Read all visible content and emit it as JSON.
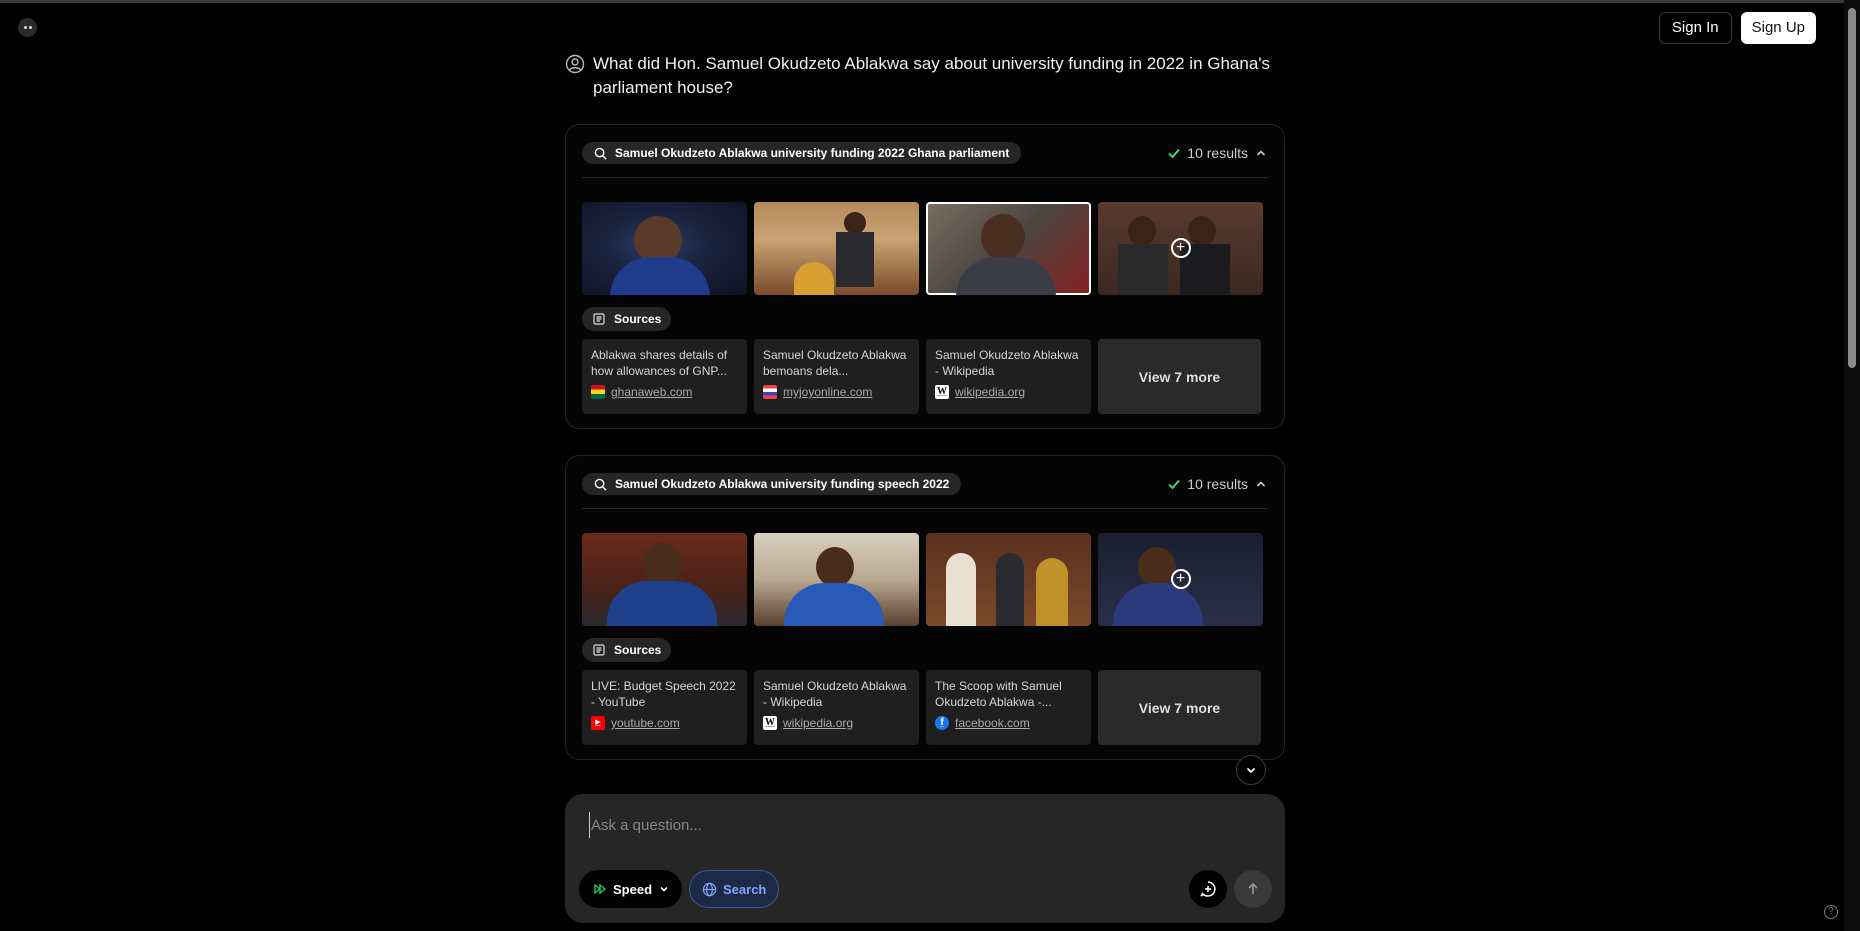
{
  "header": {
    "sign_in": "Sign In",
    "sign_up": "Sign Up"
  },
  "question": "What did Hon. Samuel Okudzeto Ablakwa say about university funding in 2022 in Ghana's parliament house?",
  "searches": [
    {
      "query": "Samuel Okudzeto Ablakwa university funding 2022 Ghana parliament",
      "results": "10 results",
      "sources_label": "Sources",
      "sources": [
        {
          "title": "Ablakwa shares details of how allowances of GNP...",
          "site": "ghanaweb.com",
          "favicon": "ghanaweb-icon"
        },
        {
          "title": "Samuel Okudzeto Ablakwa bemoans dela...",
          "site": "myjoyonline.com",
          "favicon": "myjoyonline-icon"
        },
        {
          "title": "Samuel Okudzeto Ablakwa - Wikipedia",
          "site": "wikipedia.org",
          "favicon": "wikipedia-icon"
        }
      ],
      "view_more": "View 7 more"
    },
    {
      "query": "Samuel Okudzeto Ablakwa university funding speech 2022",
      "results": "10 results",
      "sources_label": "Sources",
      "sources": [
        {
          "title": "LIVE: Budget Speech 2022 - YouTube",
          "site": "youtube.com",
          "favicon": "youtube-icon"
        },
        {
          "title": "Samuel Okudzeto Ablakwa - Wikipedia",
          "site": "wikipedia.org",
          "favicon": "wikipedia-icon"
        },
        {
          "title": "The Scoop with Samuel Okudzeto Ablakwa -...",
          "site": "facebook.com",
          "favicon": "facebook-icon"
        }
      ],
      "view_more": "View 7 more"
    }
  ],
  "composer": {
    "placeholder": "Ask a question...",
    "speed_label": "Speed",
    "search_label": "Search"
  },
  "colors": {
    "accent_blue": "#7ea6ff",
    "check_green": "#4ade80",
    "speed_green": "#22c55e"
  }
}
